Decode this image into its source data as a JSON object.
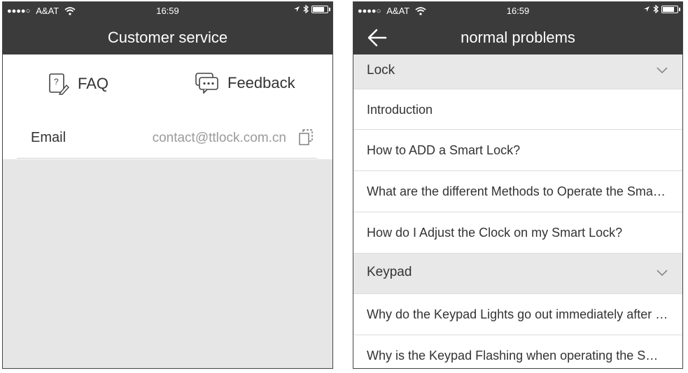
{
  "status_bar": {
    "signal": "●●●●○",
    "carrier": "A&AT",
    "time": "16:59"
  },
  "customer_service": {
    "title": "Customer service",
    "faq_label": "FAQ",
    "feedback_label": "Feedback",
    "email_label": "Email",
    "email_value": "contact@ttlock.com.cn"
  },
  "normal_problems": {
    "title": "normal problems",
    "groups": [
      {
        "label": "Lock",
        "items": [
          "Introduction",
          "How to ADD a Smart Lock?",
          "What are the different Methods to Operate the Smart Lock?",
          "How do I Adjust the Clock on my Smart Lock?"
        ]
      },
      {
        "label": "Keypad",
        "items": [
          "Why do the Keypad Lights go out immediately after touching?",
          "Why is the Keypad Flashing when operating the Smart Lock?"
        ]
      }
    ]
  },
  "colors": {
    "header_bg": "#3b3b3b",
    "body_bg": "#e6e6e6",
    "group_bg": "#e8e8e8"
  }
}
